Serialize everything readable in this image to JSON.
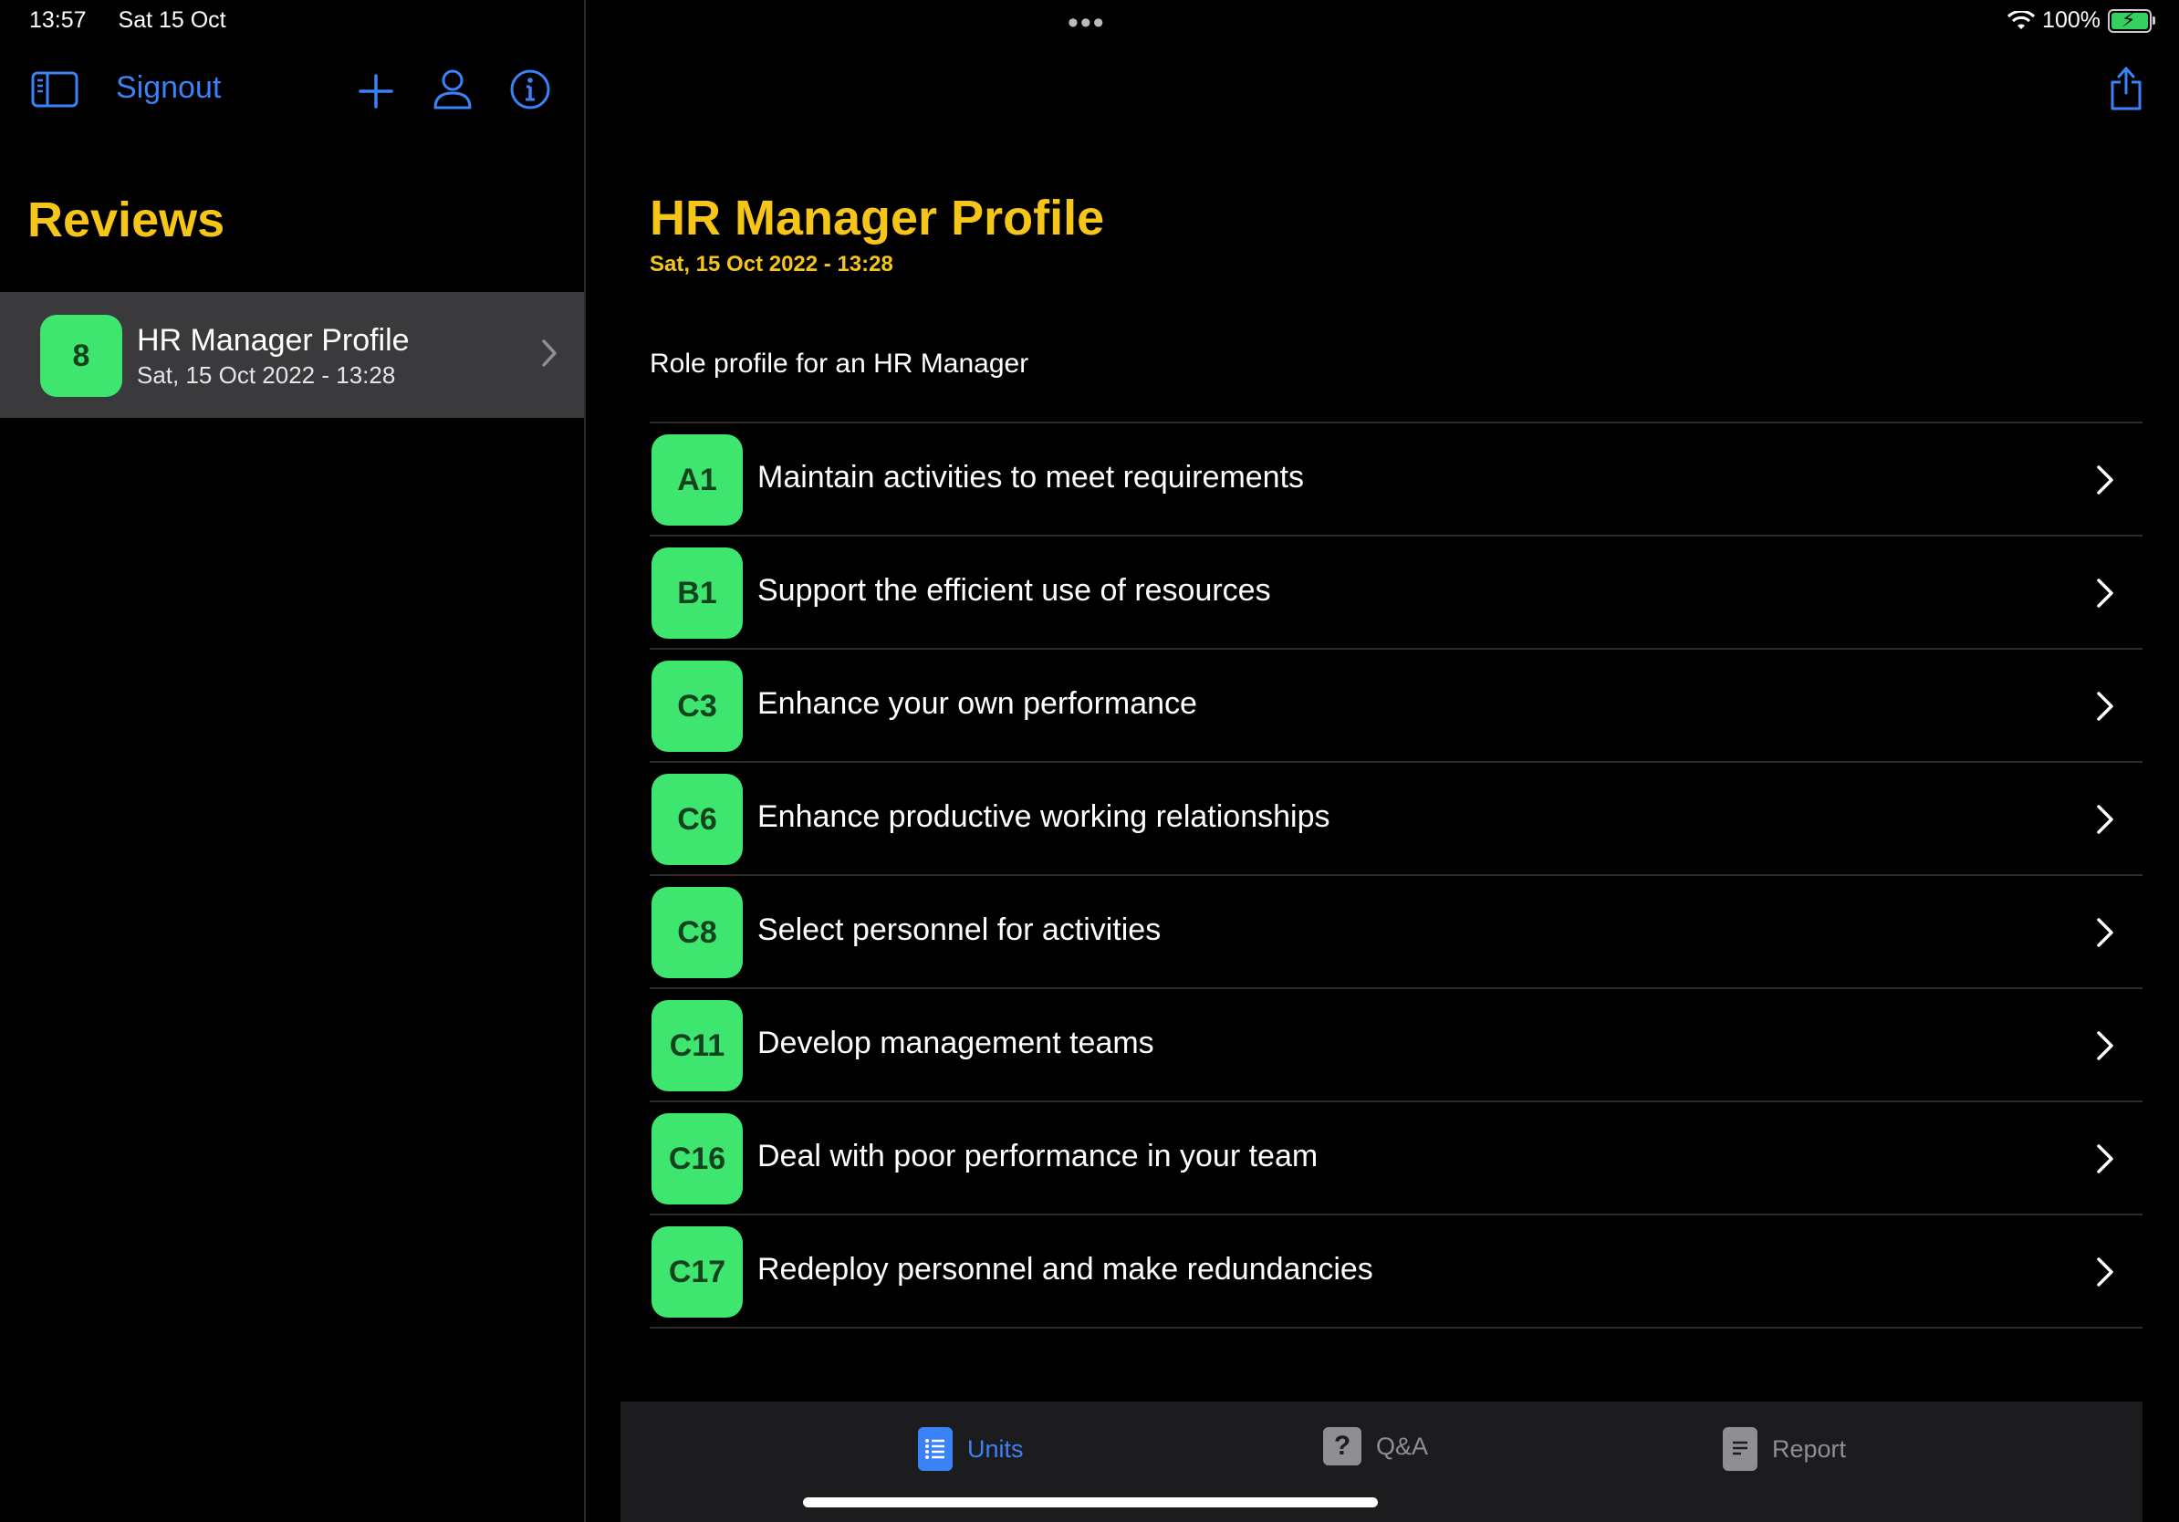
{
  "status": {
    "time": "13:57",
    "date": "Sat 15 Oct",
    "battery": "100%",
    "battery_level": 1.0
  },
  "colors": {
    "accent": "#3b82f6",
    "title": "#f5c518",
    "badge": "#3ee56f"
  },
  "sidebar": {
    "signout_label": "Signout",
    "title": "Reviews",
    "reviews": [
      {
        "badge": "8",
        "title": "HR Manager Profile",
        "date": "Sat, 15 Oct 2022 - 13:28"
      }
    ]
  },
  "detail": {
    "title": "HR Manager Profile",
    "date": "Sat, 15 Oct 2022 - 13:28",
    "description": "Role profile for an HR Manager",
    "units": [
      {
        "code": "A1",
        "label": "Maintain activities to meet requirements"
      },
      {
        "code": "B1",
        "label": "Support the efficient use of resources"
      },
      {
        "code": "C3",
        "label": "Enhance your own performance"
      },
      {
        "code": "C6",
        "label": "Enhance productive working relationships"
      },
      {
        "code": "C8",
        "label": "Select personnel for activities"
      },
      {
        "code": "C11",
        "label": "Develop management teams"
      },
      {
        "code": "C16",
        "label": "Deal with poor performance in your team"
      },
      {
        "code": "C17",
        "label": "Redeploy personnel and make redundancies"
      }
    ]
  },
  "tabs": {
    "units": "Units",
    "qa": "Q&A",
    "report": "Report",
    "qa_icon_glyph": "?"
  }
}
